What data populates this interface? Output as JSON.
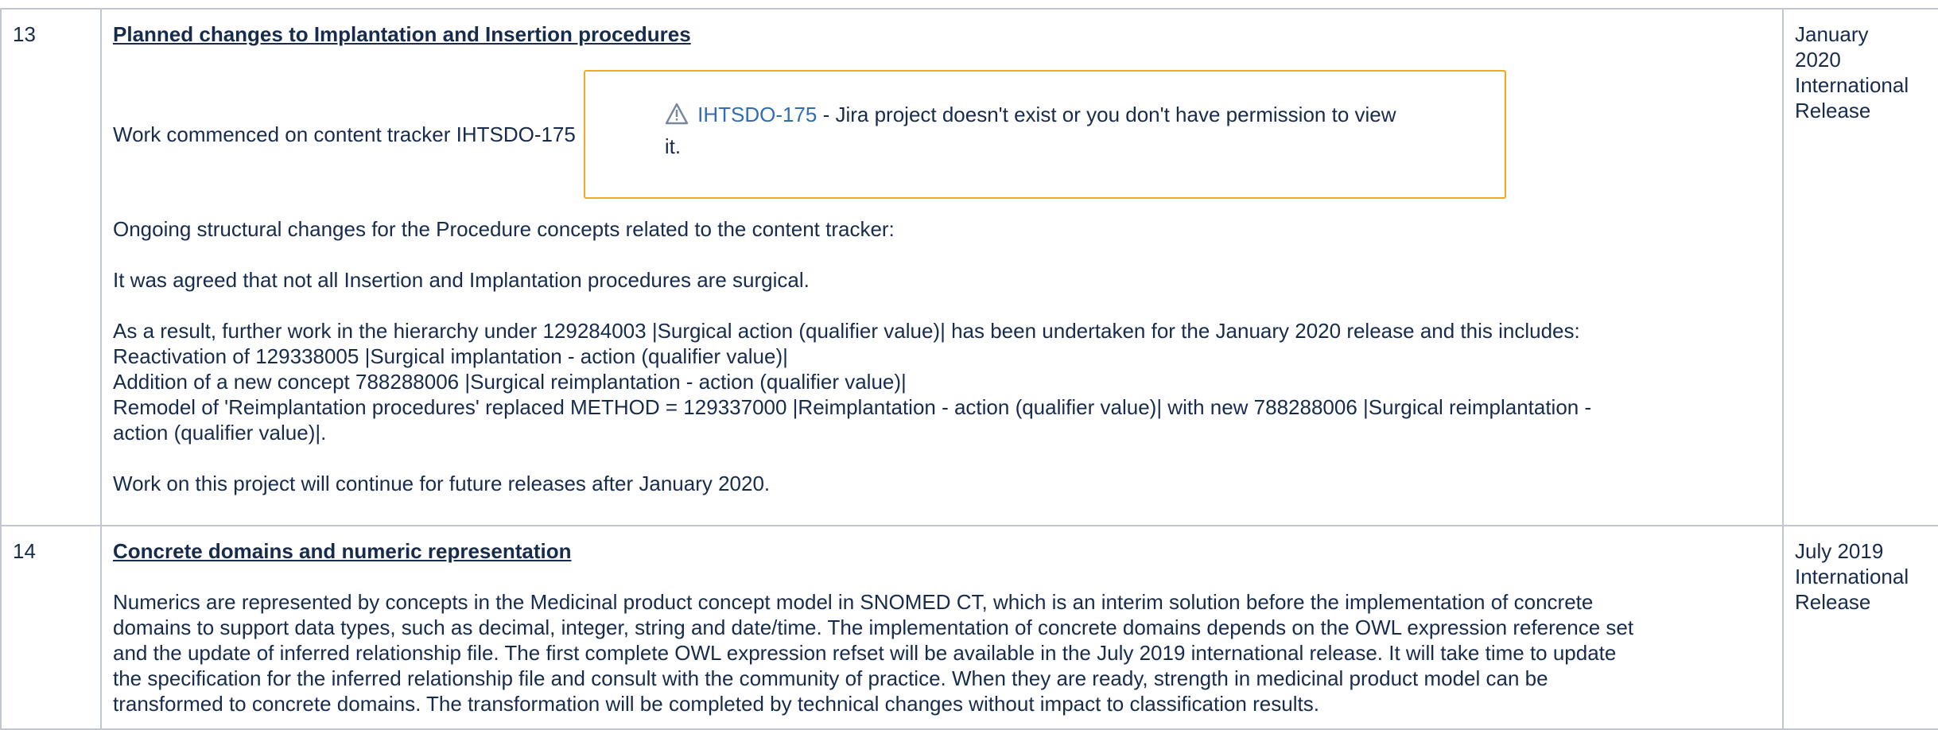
{
  "rows": [
    {
      "number": "13",
      "title": "Planned changes to Implantation and Insertion procedures",
      "tracker_text": "Work commenced on content tracker IHTSDO-175",
      "jira": {
        "key": "IHTSDO-175",
        "message_line1": " - Jira project doesn't exist or you don't have permission to view",
        "message_line2": "it.",
        "icon": "warning-icon",
        "border_color": "#f5a623",
        "link_color": "#2f6eb5"
      },
      "paragraphs": [
        "Ongoing structural changes for the Procedure concepts related to the content tracker:",
        "It was agreed that not all Insertion and Implantation procedures are surgical."
      ],
      "result_lines": [
        "As a result, further work in the hierarchy under 129284003 |Surgical action (qualifier value)| has been undertaken for the January 2020 release and this includes:",
        "Reactivation of 129338005 |Surgical implantation - action (qualifier value)|",
        "Addition of a new concept 788288006 |Surgical reimplantation - action (qualifier value)|",
        "Remodel of 'Reimplantation procedures' replaced METHOD = 129337000 |Reimplantation - action (qualifier value)| with new 788288006 |Surgical reimplantation -",
        "action (qualifier value)|."
      ],
      "closing": "Work on this project will continue for future releases after January 2020.",
      "release_lines": [
        "January",
        "2020",
        "International",
        "Release"
      ]
    },
    {
      "number": "14",
      "title": "Concrete domains and numeric representation",
      "body_lines": [
        "Numerics are represented by concepts in the Medicinal product concept model in SNOMED CT, which is an interim solution before the implementation of concrete",
        "domains to support data types, such as decimal, integer, string and date/time. The implementation of concrete domains depends on the OWL expression reference set",
        "and the update of inferred relationship file. The first complete OWL expression refset will be available in the July 2019 international release. It will take time to update",
        "the specification for the inferred relationship file and consult with the community of practice. When they are ready, strength in medicinal product model can be",
        "transformed to concrete domains. The transformation will be completed by technical changes without impact to classification results."
      ],
      "release_lines": [
        "July 2019",
        "International",
        "Release"
      ]
    }
  ]
}
